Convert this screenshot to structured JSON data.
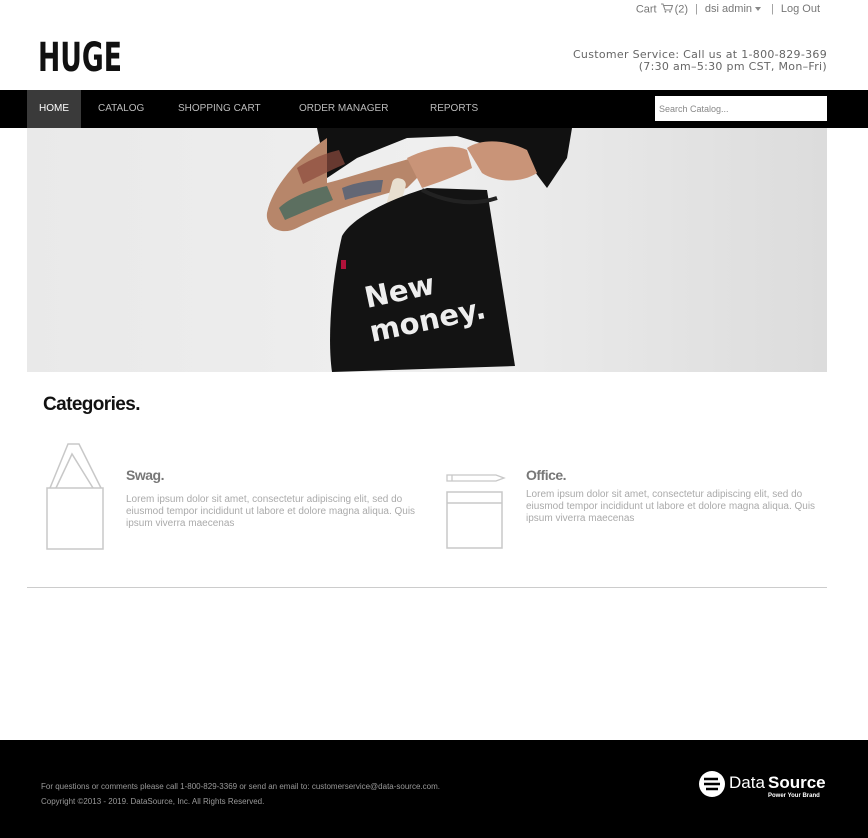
{
  "utility": {
    "cart_label": "Cart",
    "cart_count": "(2)",
    "user_label": "dsi admin",
    "logout_label": "Log Out"
  },
  "header": {
    "logo_text": "HUGE",
    "customer_service_line1": "Customer Service: Call us at 1-800-829-369",
    "customer_service_line2": "(7:30 am–5:30 pm CST, Mon–Fri)"
  },
  "nav": {
    "items": [
      "HOME",
      "CATALOG",
      "SHOPPING CART",
      "ORDER MANAGER",
      "REPORTS"
    ],
    "active_index": 0,
    "search_placeholder": "Search Catalog..."
  },
  "hero": {
    "bag_text_line1": "New",
    "bag_text_line2": "money."
  },
  "categories": {
    "title": "Categories.",
    "items": [
      {
        "name": "Swag.",
        "description": "Lorem ipsum dolor sit amet, consectetur adipiscing elit, sed do eiusmod tempor incididunt ut labore et dolore magna aliqua. Quis ipsum viverra maecenas",
        "icon": "tote-bag-icon"
      },
      {
        "name": "Office.",
        "description": "Lorem ipsum dolor sit amet, consectetur adipiscing elit, sed do eiusmod tempor incididunt ut labore et dolore magna aliqua. Quis ipsum viverra maecenas",
        "icon": "notepad-pencil-icon"
      }
    ]
  },
  "footer": {
    "contact": "For questions or comments please call 1-800-829-3369 or send an email to: customerservice@data-source.com.",
    "copyright": "Copyright ©2013 - 2019. DataSource, Inc. All Rights Reserved.",
    "brand_name_part1": "Data",
    "brand_name_part2": "Source",
    "brand_tagline": "Power Your Brand"
  },
  "colors": {
    "nav_bg": "#000000",
    "nav_active_bg": "#3a3a3a",
    "footer_bg": "#000000"
  }
}
